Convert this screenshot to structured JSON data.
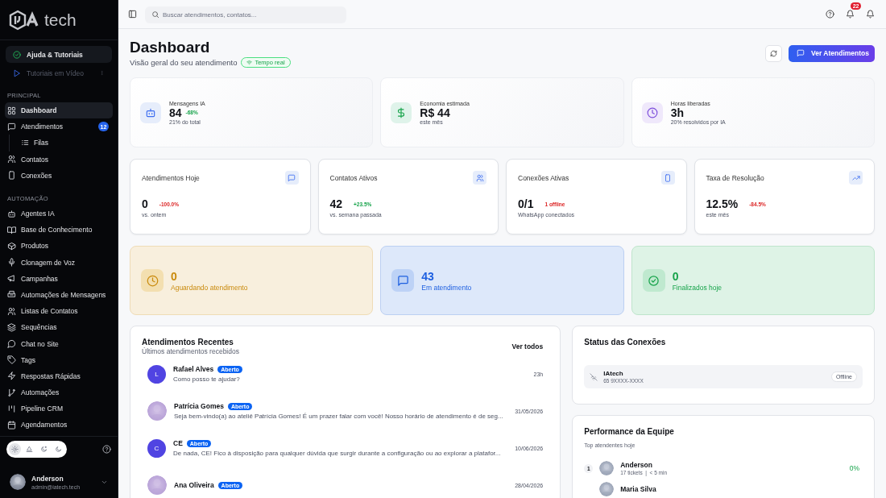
{
  "brand": {
    "wordmark": "tech"
  },
  "sidebar": {
    "help_link": {
      "label": "Ajuda & Tutoriais"
    },
    "video_link": {
      "label": "Tutoriais em Vídeo"
    },
    "sections": [
      {
        "title": "PRINCIPAL",
        "items": [
          {
            "label": "Dashboard",
            "selected": true
          },
          {
            "label": "Atendimentos",
            "selected": false,
            "badge": "12",
            "children": [
              {
                "label": "Filas",
                "selected": false
              }
            ]
          },
          {
            "label": "Contatos",
            "selected": false
          },
          {
            "label": "Conexões",
            "selected": false
          }
        ]
      },
      {
        "title": "AUTOMAÇÃO",
        "items": [
          {
            "label": "Agentes IA",
            "selected": false
          },
          {
            "label": "Base de Conhecimento",
            "selected": false
          },
          {
            "label": "Produtos",
            "selected": false
          },
          {
            "label": "Clonagem de Voz",
            "selected": false
          },
          {
            "label": "Campanhas",
            "selected": false
          },
          {
            "label": "Automações de Mensagens",
            "selected": false
          },
          {
            "label": "Listas de Contatos",
            "selected": false
          },
          {
            "label": "Sequências",
            "selected": false
          },
          {
            "label": "Chat no Site",
            "selected": false
          },
          {
            "label": "Tags",
            "selected": false
          },
          {
            "label": "Respostas Rápidas",
            "selected": false
          },
          {
            "label": "Automações",
            "selected": false
          },
          {
            "label": "Pipeline CRM",
            "selected": false
          },
          {
            "label": "Agendamentos",
            "selected": false
          }
        ]
      }
    ],
    "theme_modes": [
      {
        "selected": true
      },
      {
        "selected": false
      },
      {
        "selected": false
      },
      {
        "selected": false
      }
    ],
    "user": {
      "name": "Anderson",
      "email": "admin@iatech.tech"
    }
  },
  "topbar": {
    "search": {
      "placeholder": "Buscar atendimentos, contatos..."
    },
    "notifications_badge": "22"
  },
  "header": {
    "title": "Dashboard",
    "subtitle": "Visão geral do seu atendimento",
    "live_badge": "Tempo real",
    "primary_button": "Ver Atendimentos"
  },
  "ai_cards": [
    {
      "label": "Mensagens IA",
      "value": "84",
      "delta": {
        "text": "-68%",
        "kind": "positive",
        "trend_arrow": false
      },
      "sub": "21% do total",
      "kind": "robot"
    },
    {
      "label": "Economia estimada",
      "value": "R$ 44",
      "sub": "este mês",
      "kind": "money"
    },
    {
      "label": "Horas liberadas",
      "value": "3h",
      "sub": "20% resolvidos por IA",
      "kind": "clock"
    }
  ],
  "metric_cards": [
    {
      "label": "Atendimentos Hoje",
      "value": "0",
      "delta": {
        "text": "-100.0%",
        "kind": "negative",
        "trend_arrow": true
      },
      "sub": "vs. ontem"
    },
    {
      "label": "Contatos Ativos",
      "value": "42",
      "delta": {
        "text": "+23.5%",
        "kind": "positive",
        "trend_arrow": true
      },
      "sub": "vs. semana passada"
    },
    {
      "label": "Conexões Ativas",
      "value": "0/1",
      "delta": {
        "text": "1 offline",
        "kind": "negative",
        "trend_arrow": true
      },
      "sub": "WhatsApp conectados"
    },
    {
      "label": "Taxa de Resolução",
      "value": "12.5%",
      "delta": {
        "text": "-84.5%",
        "kind": "negative",
        "trend_arrow": true
      },
      "sub": "este mês"
    }
  ],
  "status_cards": [
    {
      "value": "0",
      "label": "Aguardando atendimento",
      "kind": "waiting"
    },
    {
      "value": "43",
      "label": "Em atendimento",
      "kind": "active"
    },
    {
      "value": "0",
      "label": "Finalizados hoje",
      "kind": "done"
    }
  ],
  "recent": {
    "title": "Atendimentos Recentes",
    "subtitle": "Últimos atendimentos recebidos",
    "link": "Ver todos",
    "rows": [
      {
        "name": "Rafael Alves",
        "status": "Aberto",
        "message": "Como posso te ajudar?",
        "time": "23h",
        "avatar": {
          "kind": "initial",
          "text": "L"
        }
      },
      {
        "name": "Patrícia Gomes",
        "status": "Aberto",
        "message": "Seja bem-vindo(a) ao ateliê Patrícia Gomes! É um prazer falar com você! Nosso horário de atendimento é de seg...",
        "time": "31/05/2026"
      },
      {
        "name": "CE",
        "status": "Aberto",
        "message": "De nada, CE! Fico à disposição para qualquer dúvida que surgir durante a configuração ou ao explorar a platafor...",
        "time": "10/06/2026",
        "avatar": {
          "kind": "initial",
          "text": "C"
        }
      },
      {
        "name": "Ana Oliveira",
        "status": "Aberto",
        "time": "28/04/2026"
      }
    ]
  },
  "connections": {
    "title": "Status das Conexões",
    "items": [
      {
        "name": "IAtech",
        "phone": "65 9XXXX-XXXX",
        "status": "Offline"
      }
    ]
  },
  "performance": {
    "title": "Performance da Equipe",
    "subtitle": "Top atendentes hoje",
    "agents": [
      {
        "rank": "1",
        "name": "Anderson",
        "stats": "17 tickets  |  < 5 min",
        "score": "0%"
      },
      {
        "name": "Maria Silva"
      }
    ]
  }
}
